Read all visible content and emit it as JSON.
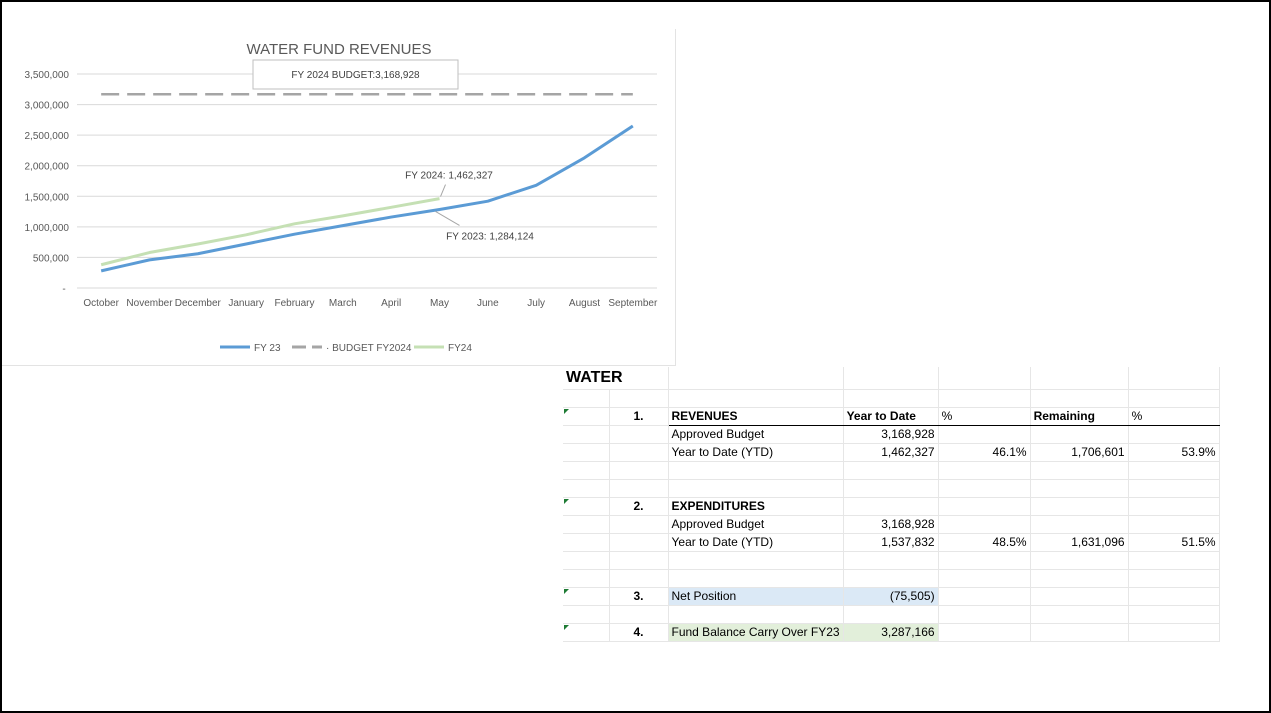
{
  "chart_data": {
    "type": "line",
    "title": "WATER FUND REVENUES",
    "categories": [
      "October",
      "November",
      "December",
      "January",
      "February",
      "March",
      "April",
      "May",
      "June",
      "July",
      "August",
      "September"
    ],
    "y_ticks": [
      "-",
      "500,000",
      "1,000,000",
      "1,500,000",
      "2,000,000",
      "2,500,000",
      "3,000,000",
      "3,500,000"
    ],
    "ylim": [
      0,
      3500000
    ],
    "grid": true,
    "legend_position": "bottom",
    "series": [
      {
        "name": "FY 23",
        "color": "#5b9bd5",
        "dashed": false,
        "values": [
          280000,
          460000,
          560000,
          720000,
          880000,
          1020000,
          1160000,
          1284124,
          1420000,
          1680000,
          2130000,
          2650000
        ]
      },
      {
        "name": "BUDGET FY2024",
        "color": "#a5a5a5",
        "dashed": true,
        "values": [
          3168928,
          3168928,
          3168928,
          3168928,
          3168928,
          3168928,
          3168928,
          3168928,
          3168928,
          3168928,
          3168928,
          3168928
        ]
      },
      {
        "name": "FY24",
        "color": "#c5e0b4",
        "dashed": false,
        "values": [
          380000,
          580000,
          720000,
          870000,
          1050000,
          1180000,
          1320000,
          1462327
        ]
      }
    ],
    "annotations": {
      "budget": "FY 2024 BUDGET:3,168,928",
      "fy24": "FY 2024: 1,462,327",
      "fy23": "FY 2023:  1,284,124"
    }
  },
  "table": {
    "title": "WATER",
    "sec1_num": "1.",
    "sec1_label": "REVENUES",
    "col_ytd": "Year to Date",
    "col_pct": "%",
    "col_remaining": "Remaining",
    "col_pct2": "%",
    "rev_budget_label": "Approved Budget",
    "rev_budget_value": "3,168,928",
    "rev_ytd_label": "Year to Date (YTD)",
    "rev_ytd_value": "1,462,327",
    "rev_ytd_pct": "46.1%",
    "rev_remaining": "1,706,601",
    "rev_remaining_pct": "53.9%",
    "sec2_num": "2.",
    "sec2_label": "EXPENDITURES",
    "exp_budget_label": "Approved Budget",
    "exp_budget_value": "3,168,928",
    "exp_ytd_label": "Year to Date (YTD)",
    "exp_ytd_value": "1,537,832",
    "exp_ytd_pct": "48.5%",
    "exp_remaining": "1,631,096",
    "exp_remaining_pct": "51.5%",
    "sec3_num": "3.",
    "net_label": "Net Position",
    "net_value": "(75,505)",
    "sec4_num": "4.",
    "fund_label": "Fund Balance Carry Over FY23",
    "fund_value": "3,287,166"
  }
}
